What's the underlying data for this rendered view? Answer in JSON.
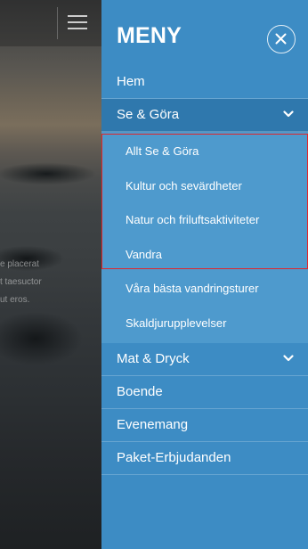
{
  "background": {
    "text_lines": "e placerat\nt taesuctor\nut eros."
  },
  "menu": {
    "title": "MENY",
    "items": [
      {
        "label": "Hem"
      },
      {
        "label": "Se & Göra",
        "expanded": true
      },
      {
        "label": "Mat & Dryck",
        "expanded": false
      },
      {
        "label": "Boende"
      },
      {
        "label": "Evenemang"
      },
      {
        "label": "Paket-Erbjudanden"
      }
    ],
    "submenu": [
      {
        "label": "Allt Se & Göra"
      },
      {
        "label": "Kultur och sevärdheter"
      },
      {
        "label": "Natur och friluftsaktiviteter"
      },
      {
        "label": "Vandra"
      },
      {
        "label": "Våra bästa vandringsturer"
      },
      {
        "label": "Skaldjurupplevelser"
      }
    ]
  },
  "colors": {
    "menu_bg": "#3d8cc4",
    "active_item_bg": "#2f78ad",
    "submenu_bg": "#4e9acd",
    "highlight_border": "#e0262b"
  },
  "icons": {
    "hamburger": "hamburger-icon",
    "close": "close-icon",
    "chevron": "chevron-down-icon"
  }
}
